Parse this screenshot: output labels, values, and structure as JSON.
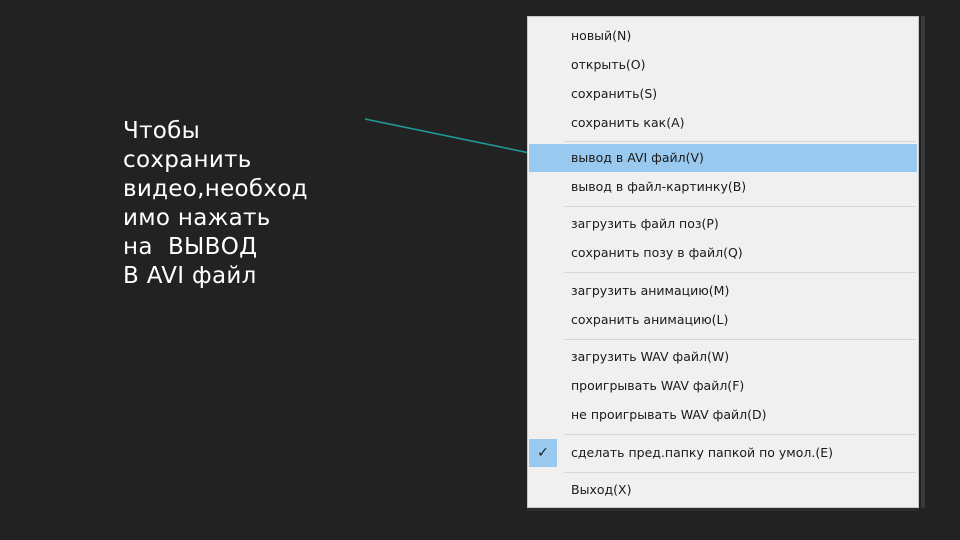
{
  "slide": {
    "lines": [
      "Чтобы",
      "сохранить",
      "видео,необход",
      "имо нажать",
      "на  ВЫВОД",
      "В AVI файл"
    ]
  },
  "menu": {
    "items": [
      {
        "label": "новый(N)"
      },
      {
        "label": "открыть(O)"
      },
      {
        "label": "сохранить(S)"
      },
      {
        "label": "сохранить как(A)"
      },
      {
        "label": "вывод в AVI файл(V)",
        "highlighted": true
      },
      {
        "label": "вывод в файл-картинку(B)"
      },
      {
        "label": "загрузить файл поз(P)"
      },
      {
        "label": "сохранить позу в файл(Q)"
      },
      {
        "label": "загрузить анимацию(M)"
      },
      {
        "label": "сохранить анимацию(L)"
      },
      {
        "label": "загрузить WAV файл(W)"
      },
      {
        "label": "проигрывать WAV файл(F)"
      },
      {
        "label": "не проигрывать WAV файл(D)"
      },
      {
        "label": "сделать пред.папку папкой по умол.(E)",
        "checked": true
      },
      {
        "label": "Выход(X)"
      }
    ]
  },
  "colors": {
    "background": "#222222",
    "highlight": "#99c9ef",
    "pointer_line": "#1f9a96",
    "menu_bg": "#f0f0f0"
  },
  "icons": {
    "checkmark": "check-icon"
  }
}
